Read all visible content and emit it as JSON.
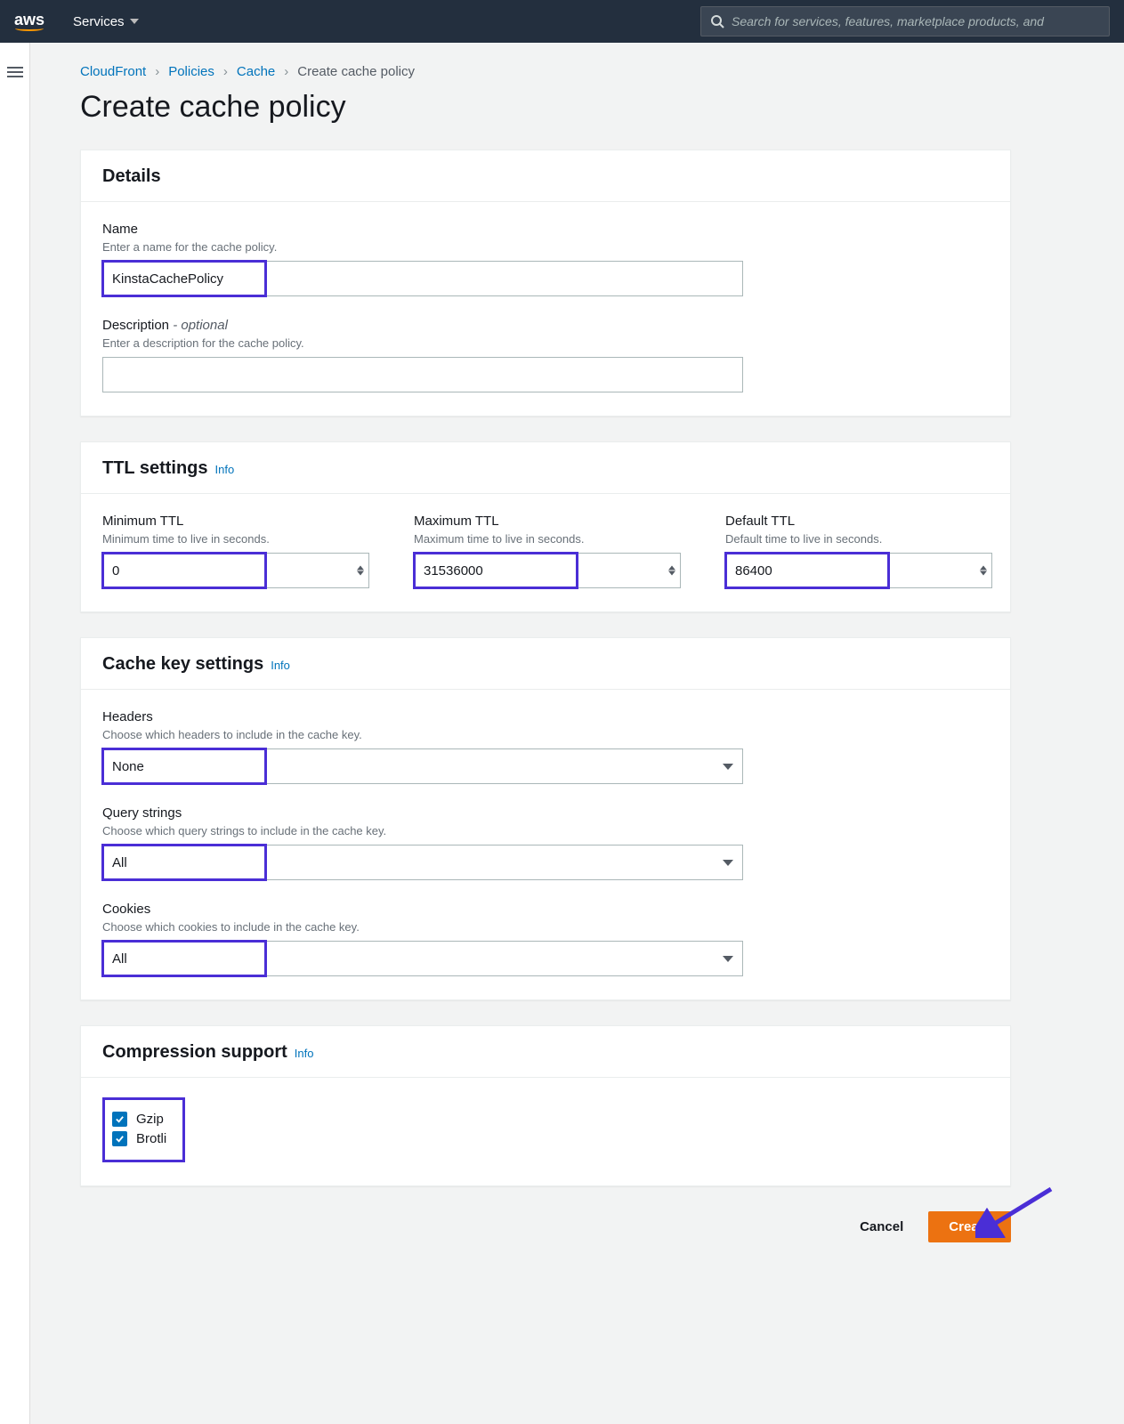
{
  "topnav": {
    "services_label": "Services",
    "search_placeholder": "Search for services, features, marketplace products, and"
  },
  "breadcrumbs": {
    "items": [
      "CloudFront",
      "Policies",
      "Cache"
    ],
    "current": "Create cache policy"
  },
  "page_title": "Create cache policy",
  "panels": {
    "details": {
      "title": "Details",
      "name_label": "Name",
      "name_help": "Enter a name for the cache policy.",
      "name_value": "KinstaCachePolicy",
      "desc_label": "Description",
      "desc_optional": " - optional",
      "desc_help": "Enter a description for the cache policy.",
      "desc_value": ""
    },
    "ttl": {
      "title": "TTL settings",
      "info": "Info",
      "min_label": "Minimum TTL",
      "min_help": "Minimum time to live in seconds.",
      "min_value": "0",
      "max_label": "Maximum TTL",
      "max_help": "Maximum time to live in seconds.",
      "max_value": "31536000",
      "def_label": "Default TTL",
      "def_help": "Default time to live in seconds.",
      "def_value": "86400"
    },
    "cachekey": {
      "title": "Cache key settings",
      "info": "Info",
      "headers_label": "Headers",
      "headers_help": "Choose which headers to include in the cache key.",
      "headers_value": "None",
      "qs_label": "Query strings",
      "qs_help": "Choose which query strings to include in the cache key.",
      "qs_value": "All",
      "cookies_label": "Cookies",
      "cookies_help": "Choose which cookies to include in the cache key.",
      "cookies_value": "All"
    },
    "compression": {
      "title": "Compression support",
      "info": "Info",
      "gzip_label": "Gzip",
      "gzip_checked": true,
      "brotli_label": "Brotli",
      "brotli_checked": true
    }
  },
  "footer": {
    "cancel": "Cancel",
    "create": "Create"
  }
}
